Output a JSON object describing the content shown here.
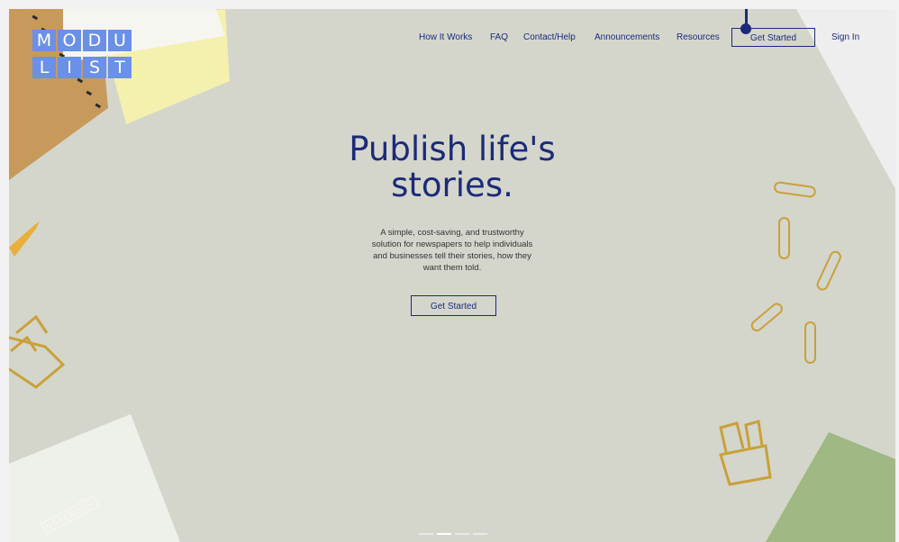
{
  "logo": {
    "letters": [
      "M",
      "O",
      "D",
      "U",
      "L",
      "I",
      "S",
      "T"
    ]
  },
  "nav": {
    "items": [
      {
        "label": "How It Works"
      },
      {
        "label": "FAQ"
      },
      {
        "label": "Contact/Help"
      },
      {
        "label": "Announcements"
      },
      {
        "label": "Resources"
      }
    ],
    "cta_label": "Get Started",
    "signin_label": "Sign In"
  },
  "hero": {
    "title_line1": "Publish life's",
    "title_line2": "stories.",
    "description_lines": [
      "A simple, cost-saving, and trustworthy",
      "solution for newspapers to help individuals",
      "and businesses tell their stories, how they",
      "want them told."
    ],
    "cta_label": "Get Started"
  },
  "decor": {
    "notebook_label": "NOTEBOOK"
  },
  "colors": {
    "accent": "#1c2a7a",
    "logo_blue": "#6a90e8",
    "background": "#d4d6cc"
  }
}
